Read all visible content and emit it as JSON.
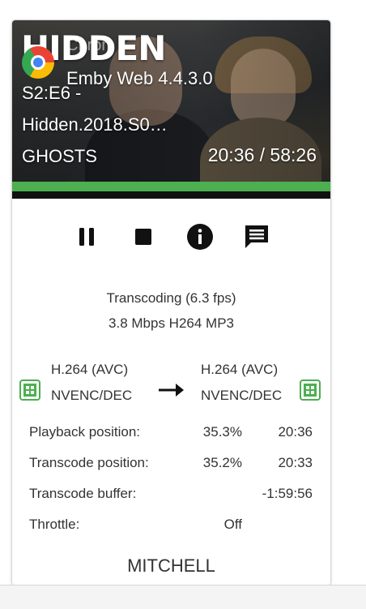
{
  "overlay": {
    "show_logo": "HIDDEN",
    "window_title_faint": "Chrom",
    "app_title": "Emby Web 4.4.3.0"
  },
  "now_playing": {
    "episode": "S2:E6 -",
    "filename": "Hidden.2018.S0…",
    "user": "GHOSTS",
    "time": "20:36 / 58:26",
    "progress_percent": 35.3,
    "transcode_percent": 35.2
  },
  "controls": {
    "pause_icon": "pause-icon",
    "stop_icon": "stop-icon",
    "info_icon": "info-icon",
    "message_icon": "message-icon"
  },
  "status": {
    "line1": "Transcoding (6.3 fps)",
    "line2": "3.8 Mbps H264 MP3"
  },
  "codec": {
    "source_line1": "H.264 (AVC)",
    "source_line2": "NVENC/DEC",
    "target_line1": "H.264 (AVC)",
    "target_line2": "NVENC/DEC",
    "chip_color": "#4caf50"
  },
  "stats": [
    {
      "label": "Playback position:",
      "percent": "35.3%",
      "time": "20:36"
    },
    {
      "label": "Transcode position:",
      "percent": "35.2%",
      "time": "20:33"
    },
    {
      "label": "Transcode buffer:",
      "percent": "",
      "time": "-1:59:56"
    },
    {
      "label": "Throttle:",
      "percent": "Off",
      "time": ""
    }
  ],
  "next_user": "MITCHELL",
  "colors": {
    "accent": "#4caf50",
    "text": "#333333",
    "icon": "#111111"
  }
}
